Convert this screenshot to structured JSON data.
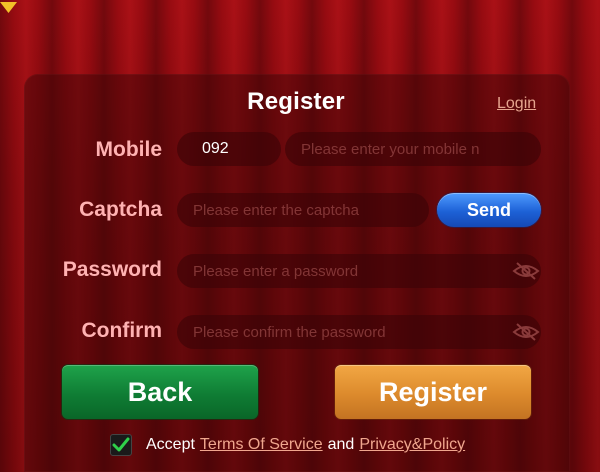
{
  "header": {
    "title": "Register",
    "login_link": "Login"
  },
  "form": {
    "mobile": {
      "label": "Mobile",
      "country_code": "092",
      "placeholder": "Please enter your mobile n"
    },
    "captcha": {
      "label": "Captcha",
      "placeholder": "Please enter the captcha",
      "send_label": "Send"
    },
    "password": {
      "label": "Password",
      "placeholder": "Please enter a password"
    },
    "confirm": {
      "label": "Confirm",
      "placeholder": "Please confirm the password"
    }
  },
  "actions": {
    "back_label": "Back",
    "register_label": "Register"
  },
  "agreement": {
    "checked": true,
    "prefix": "Accept",
    "terms_link": "Terms Of Service",
    "conjunction": "and",
    "privacy_link": "Privacy&Policy"
  },
  "icons": {
    "dropdown": "caret-down-icon",
    "password_visibility": "eye-off-icon",
    "checkbox": "checkmark-icon"
  },
  "colors": {
    "background": "#8a0a0f",
    "label": "#ffb2b2",
    "link": "#e6a48e",
    "caret": "#f2c028",
    "send_button": "#1d61d6",
    "back_button": "#0f7d34",
    "register_button": "#dc8a2c",
    "checkmark": "#2fd14a"
  }
}
